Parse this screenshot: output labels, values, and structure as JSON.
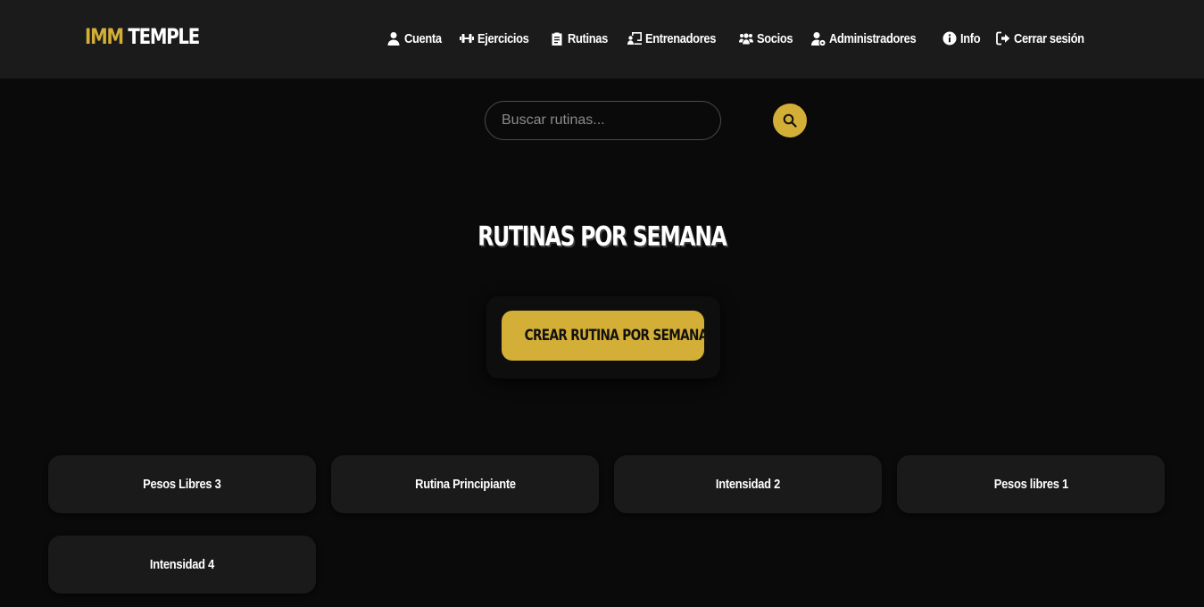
{
  "brand": {
    "accent": "IMM",
    "rest": "TEMPLE",
    "accent_color": "#d4af37"
  },
  "nav": [
    {
      "label": "Cuenta",
      "icon": "user-icon"
    },
    {
      "label": "Ejercicios",
      "icon": "dumbbell-icon"
    },
    {
      "label": "Rutinas",
      "icon": "clipboard-icon"
    },
    {
      "label": "Entrenadores",
      "icon": "chalkboard-user-icon"
    },
    {
      "label": "Socios",
      "icon": "users-icon"
    },
    {
      "label": "Administradores",
      "icon": "user-gear-icon"
    },
    {
      "label": "Info",
      "icon": "info-icon"
    },
    {
      "label": "Cerrar sesión",
      "icon": "logout-icon"
    }
  ],
  "search": {
    "placeholder": "Buscar rutinas...",
    "value": "",
    "icon": "search-icon"
  },
  "page": {
    "title": "RUTINAS POR SEMANA",
    "create_label": "CREAR RUTINA POR SEMANA"
  },
  "routines": [
    {
      "name": "Pesos Libres 3"
    },
    {
      "name": "Rutina Principiante"
    },
    {
      "name": "Intensidad 2"
    },
    {
      "name": "Pesos libres 1"
    },
    {
      "name": "Intensidad 4"
    }
  ]
}
